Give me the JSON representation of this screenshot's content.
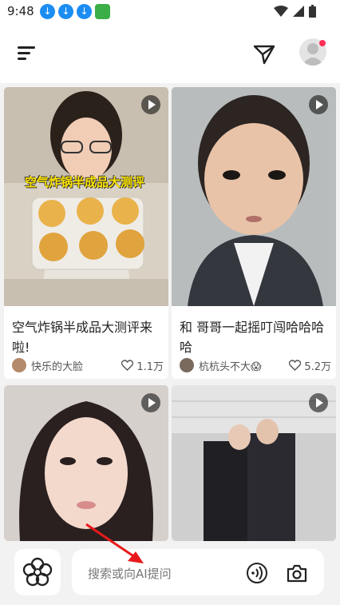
{
  "status_bar": {
    "time": "9:48",
    "download_icons": [
      "download-icon",
      "download-icon",
      "download-icon"
    ],
    "app_icon": "app-notification-icon",
    "right_icons": [
      "wifi-icon",
      "signal-icon",
      "battery-icon"
    ]
  },
  "header": {
    "menu_icon": "menu-icon",
    "send_icon": "paper-plane-icon",
    "avatar_badge_color": "#ff2d55"
  },
  "feed": [
    {
      "title": "空气炸锅半成品大测评来啦!",
      "overlay_text": "空气炸锅半成品大测评",
      "author": "快乐的大脸",
      "likes": "1.1万"
    },
    {
      "title": "和 哥哥一起摇叮闯哈哈哈哈",
      "author": "杭杭头不大😱",
      "likes": "5.2万"
    },
    {
      "title": "",
      "author": "",
      "likes": ""
    },
    {
      "title": "",
      "author": "",
      "likes": ""
    }
  ],
  "bottom_bar": {
    "search_placeholder": "搜索或向AI提问",
    "left_icon": "flower-icon",
    "voice_icon": "voice-icon",
    "camera_icon": "camera-icon"
  },
  "colors": {
    "accent_red": "#ff2d55",
    "annotation_arrow": "#e8191a",
    "overlay_yellow": "#ffe600"
  }
}
